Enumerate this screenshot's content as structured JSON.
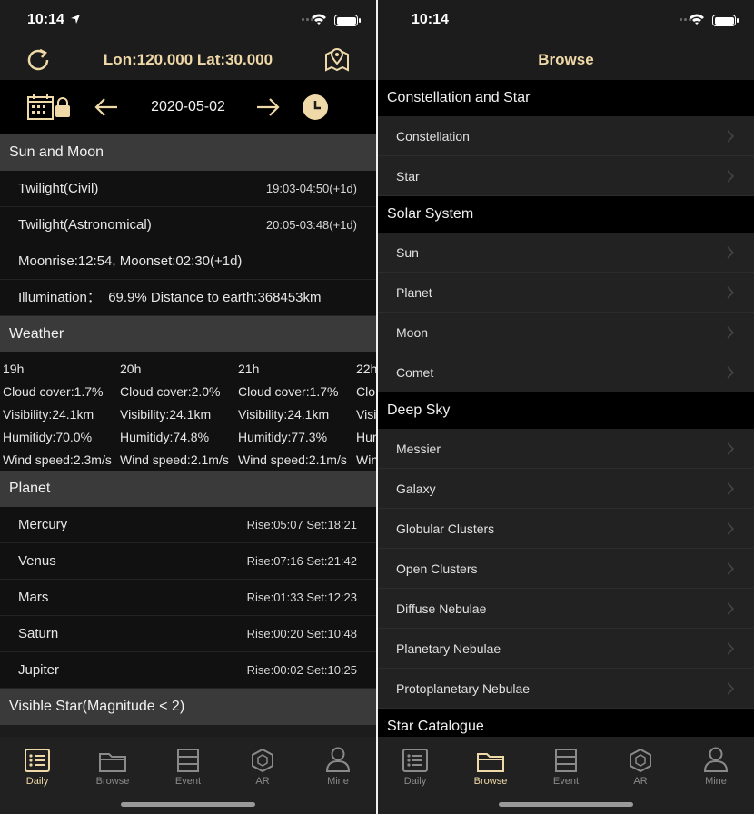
{
  "left": {
    "status": {
      "time": "10:14"
    },
    "header": {
      "coord": "Lon:120.000 Lat:30.000"
    },
    "datebar": {
      "date": "2020-05-02"
    },
    "sun_moon": {
      "title": "Sun and Moon",
      "rows": [
        {
          "label": "Twilight(Civil)",
          "value": "19:03-04:50(+1d)"
        },
        {
          "label": "Twilight(Astronomical)",
          "value": "20:05-03:48(+1d)"
        },
        {
          "label": "Moonrise:12:54, Moonset:02:30(+1d)",
          "value": ""
        },
        {
          "label": "Illumination：  69.9% Distance to earth:368453km",
          "value": ""
        }
      ]
    },
    "weather": {
      "title": "Weather",
      "columns": [
        {
          "hour": "19h",
          "cloud": "Cloud cover:1.7%",
          "vis": "Visibility:24.1km",
          "hum": "Humitidy:70.0%",
          "wind": "Wind speed:2.3m/s"
        },
        {
          "hour": "20h",
          "cloud": "Cloud cover:2.0%",
          "vis": "Visibility:24.1km",
          "hum": "Humitidy:74.8%",
          "wind": "Wind speed:2.1m/s"
        },
        {
          "hour": "21h",
          "cloud": "Cloud cover:1.7%",
          "vis": "Visibility:24.1km",
          "hum": "Humitidy:77.3%",
          "wind": "Wind speed:2.1m/s"
        },
        {
          "hour": "22h",
          "cloud": "Clo",
          "vis": "Visi",
          "hum": "Hur",
          "wind": "Win"
        }
      ]
    },
    "planet": {
      "title": "Planet",
      "rows": [
        {
          "label": "Mercury",
          "value": "Rise:05:07 Set:18:21"
        },
        {
          "label": "Venus",
          "value": "Rise:07:16 Set:21:42"
        },
        {
          "label": "Mars",
          "value": "Rise:01:33 Set:12:23"
        },
        {
          "label": "Saturn",
          "value": "Rise:00:20 Set:10:48"
        },
        {
          "label": "Jupiter",
          "value": "Rise:00:02 Set:10:25"
        }
      ]
    },
    "visible_star": {
      "title": "Visible Star(Magnitude < 2)"
    }
  },
  "right": {
    "status": {
      "time": "10:14"
    },
    "title": "Browse",
    "groups": [
      {
        "title": "Constellation and Star",
        "items": [
          "Constellation",
          "Star"
        ]
      },
      {
        "title": "Solar System",
        "items": [
          "Sun",
          "Planet",
          "Moon",
          "Comet"
        ]
      },
      {
        "title": "Deep Sky",
        "items": [
          "Messier",
          "Galaxy",
          "Globular Clusters",
          "Open Clusters",
          "Diffuse Nebulae",
          "Planetary Nebulae",
          "Protoplanetary Nebulae"
        ]
      },
      {
        "title": "Star Catalogue",
        "items": []
      }
    ]
  },
  "tabs": [
    {
      "label": "Daily",
      "icon": "list-icon"
    },
    {
      "label": "Browse",
      "icon": "folder-icon"
    },
    {
      "label": "Event",
      "icon": "server-icon"
    },
    {
      "label": "AR",
      "icon": "hexagon-icon"
    },
    {
      "label": "Mine",
      "icon": "person-icon"
    }
  ],
  "colors": {
    "accent": "#f0d9a8",
    "inactive": "#8a8a8a",
    "section": "#3a3a3a"
  }
}
